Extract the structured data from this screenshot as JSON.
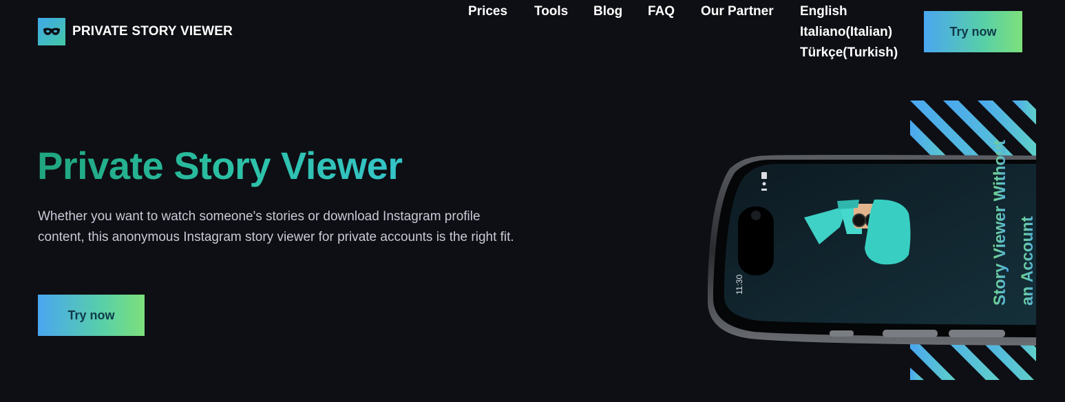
{
  "header": {
    "brand": "PRIVATE STORY VIEWER",
    "nav": {
      "prices": "Prices",
      "tools": "Tools",
      "blog": "Blog",
      "faq": "FAQ",
      "partner": "Our Partner"
    },
    "languages": [
      "English",
      "Italiano(Italian)",
      "Türkçe(Turkish)"
    ],
    "cta_label": "Try now"
  },
  "hero": {
    "title": "Private Story Viewer",
    "description": "Whether you want to watch someone's stories or download Instagram profile content, this anonymous Instagram story viewer for private accounts is the right fit.",
    "cta_label": "Try now"
  },
  "phone": {
    "time": "11:30",
    "line1": "Story Viewer Without",
    "line2": "an Account"
  },
  "icons": {
    "logo": "mask-icon"
  },
  "colors": {
    "background": "#0e0f14",
    "accent_start": "#4aa6f0",
    "accent_end": "#7de07b",
    "title_green": "#1fa57f"
  }
}
